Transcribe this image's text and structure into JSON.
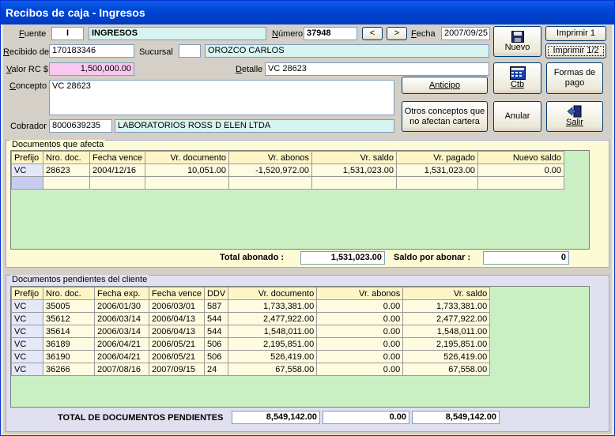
{
  "window": {
    "title": "Recibos de caja - Ingresos"
  },
  "header": {
    "fuente_label": "Fuente",
    "fuente_code": "I",
    "fuente_name": "INGRESOS",
    "numero_label": "Número",
    "numero_value": "37948",
    "prev_label": "<",
    "next_label": ">",
    "fecha_label": "Fecha",
    "fecha_value": "2007/09/25",
    "recibido_label": "Recibido de",
    "recibido_value": "170183346",
    "sucursal_label": "Sucursal",
    "sucursal_value": "",
    "client_name": "OROZCO CARLOS",
    "valor_label": "Valor RC $",
    "valor_value": "1,500,000.00",
    "detalle_label": "Detalle",
    "detalle_value": "VC 28623",
    "concepto_label": "Concepto",
    "concepto_value": "VC 28623",
    "cobrador_label": "Cobrador",
    "cobrador_code": "8000639235",
    "cobrador_name": "LABORATORIOS ROSS  D ELEN LTDA"
  },
  "buttons": {
    "nuevo": "Nuevo",
    "imprimir1": "Imprimir 1",
    "imprimir12": "Imprimir 1/2",
    "anticipo": "Anticipo",
    "ctb": "Ctb",
    "formas_pago": "Formas de pago",
    "otros_conceptos": "Otros conceptos que no afectan cartera",
    "anular": "Anular",
    "salir": "Salir"
  },
  "afecta": {
    "title": "Documentos que afecta",
    "columns": [
      "Prefijo",
      "Nro. doc.",
      "Fecha vence",
      "Vr. documento",
      "Vr. abonos",
      "Vr. saldo",
      "Vr. pagado",
      "Nuevo saldo"
    ],
    "rows": [
      [
        "VC",
        "28623",
        "2004/12/16",
        "10,051.00",
        "-1,520,972.00",
        "1,531,023.00",
        "1,531,023.00",
        "0.00"
      ]
    ],
    "total_abonado_label": "Total abonado :",
    "total_abonado_value": "1,531,023.00",
    "saldo_label": "Saldo por abonar :",
    "saldo_value": "0"
  },
  "pendientes": {
    "title": "Documentos pendientes del cliente",
    "columns": [
      "Prefijo",
      "Nro. doc.",
      "Fecha exp.",
      "Fecha vence",
      "DDV",
      "Vr. documento",
      "Vr. abonos",
      "Vr. saldo"
    ],
    "rows": [
      [
        "VC",
        "35005",
        "2006/01/30",
        "2006/03/01",
        "587",
        "1,733,381.00",
        "0.00",
        "1,733,381.00"
      ],
      [
        "VC",
        "35612",
        "2006/03/14",
        "2006/04/13",
        "544",
        "2,477,922.00",
        "0.00",
        "2,477,922.00"
      ],
      [
        "VC",
        "35614",
        "2006/03/14",
        "2006/04/13",
        "544",
        "1,548,011.00",
        "0.00",
        "1,548,011.00"
      ],
      [
        "VC",
        "36189",
        "2006/04/21",
        "2006/05/21",
        "506",
        "2,195,851.00",
        "0.00",
        "2,195,851.00"
      ],
      [
        "VC",
        "36190",
        "2006/04/21",
        "2006/05/21",
        "506",
        "526,419.00",
        "0.00",
        "526,419.00"
      ],
      [
        "VC",
        "36266",
        "2007/08/16",
        "2007/09/15",
        "24",
        "67,558.00",
        "0.00",
        "67,558.00"
      ]
    ],
    "total_label": "TOTAL  DE DOCUMENTOS PENDIENTES",
    "total_documento": "8,549,142.00",
    "total_abonos": "0.00",
    "total_saldo": "8,549,142.00"
  },
  "colors": {
    "title_bar": "#0046d5",
    "panel_bg": "#fdfbd6",
    "grid_bg": "#c9efc2",
    "valor_bg": "#f8c8f0",
    "info_field_bg": "#d8f4f0"
  }
}
